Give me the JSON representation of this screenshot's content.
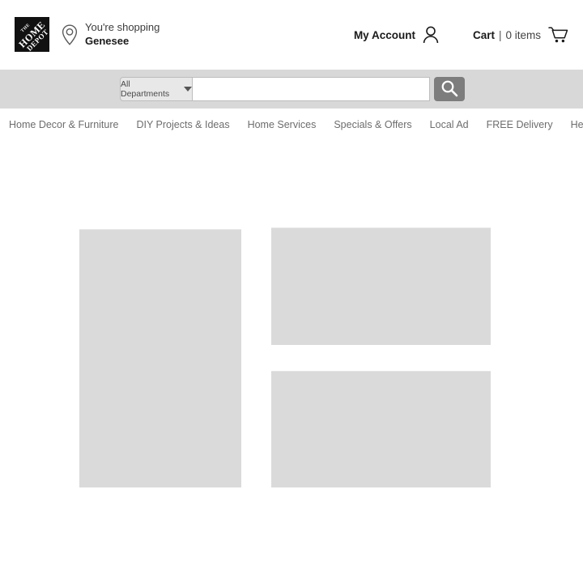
{
  "header": {
    "logo": {
      "icon": "home-depot-logo",
      "line1": "THE",
      "line2": "HOME",
      "line3": "DEPOT"
    },
    "store": {
      "pin_icon": "location-pin-icon",
      "label": "You're shopping",
      "name": "Genesee"
    },
    "account": {
      "label": "My Account",
      "icon": "user-icon"
    },
    "cart": {
      "label": "Cart",
      "separator": "|",
      "items_text": "0 items",
      "icon": "shopping-cart-icon"
    }
  },
  "search": {
    "department_label": "All Departments",
    "department_caret_icon": "chevron-down-icon",
    "input_value": "",
    "input_placeholder": "",
    "button_icon": "search-icon"
  },
  "nav": {
    "items": [
      {
        "label": "Home Decor & Furniture"
      },
      {
        "label": "DIY Projects & Ideas"
      },
      {
        "label": "Home Services"
      },
      {
        "label": "Specials & Offers"
      },
      {
        "label": "Local Ad"
      },
      {
        "label": "FREE Delivery"
      },
      {
        "label": "Help"
      }
    ]
  },
  "main": {
    "placeholders": [
      {
        "name": "hero-image-placeholder",
        "content": ""
      },
      {
        "name": "promo-top-placeholder",
        "content": ""
      },
      {
        "name": "promo-bottom-placeholder",
        "content": ""
      }
    ]
  },
  "colors": {
    "page_background": "#ffffff",
    "search_band": "#d8d8d8",
    "placeholder_fill": "#dadada",
    "search_button": "#7d7d7d",
    "logo_background": "#111111",
    "nav_text": "#6d6d6d"
  }
}
